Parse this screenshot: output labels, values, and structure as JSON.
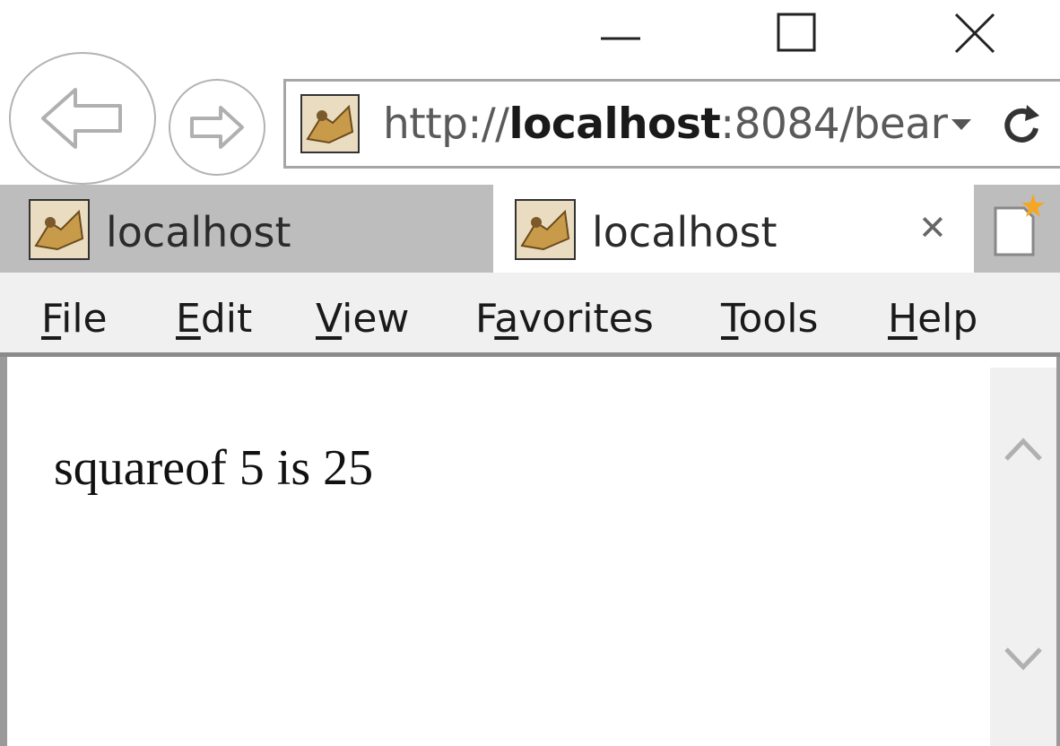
{
  "window": {
    "controls": [
      "minimize",
      "maximize",
      "close"
    ]
  },
  "nav": {
    "back_icon": "back-arrow-icon",
    "forward_icon": "forward-arrow-icon"
  },
  "address": {
    "prefix": "http://",
    "host": "localhost",
    "rest": ":8084/bear",
    "favicon": "tomcat-icon",
    "dropdown_icon": "chevron-down-icon",
    "refresh_icon": "refresh-icon"
  },
  "tabs": [
    {
      "title": "localhost",
      "active": false,
      "favicon": "tomcat-icon"
    },
    {
      "title": "localhost",
      "active": true,
      "favicon": "tomcat-icon",
      "close_glyph": "✕"
    }
  ],
  "new_tab_icon": "new-tab-icon",
  "menu": {
    "items": [
      {
        "key": "F",
        "rest": "ile"
      },
      {
        "key": "E",
        "rest": "dit"
      },
      {
        "key": "V",
        "rest": "iew"
      },
      {
        "pre": "F",
        "key": "a",
        "rest": "vorites"
      },
      {
        "key": "T",
        "rest": "ools"
      },
      {
        "key": "H",
        "rest": "elp"
      }
    ]
  },
  "page": {
    "text": "squareof 5 is 25"
  },
  "colors": {
    "tabstrip": "#bdbdbd",
    "menubar": "#f0f0f0",
    "active_tab": "#ffffff",
    "new_tab_star": "#f5a623"
  }
}
